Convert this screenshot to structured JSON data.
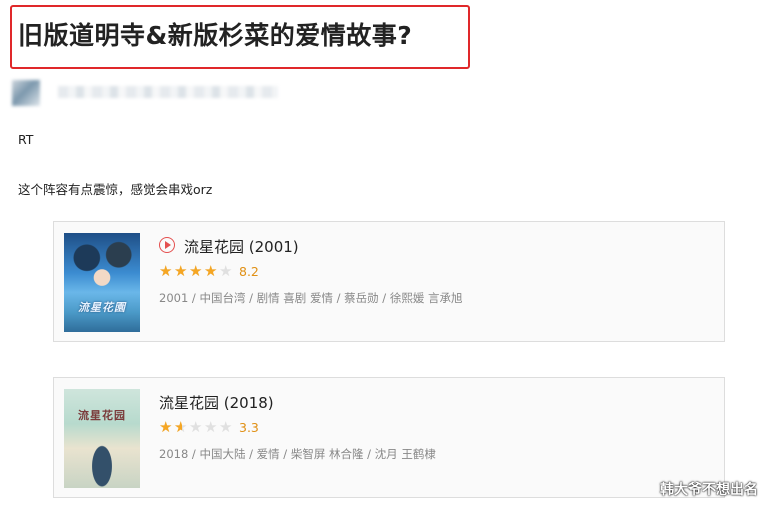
{
  "post": {
    "title": "旧版道明寺&新版杉菜的爱情故事?",
    "paragraph1": "RT",
    "paragraph2": "这个阵容有点震惊，感觉会串戏orz"
  },
  "cards": [
    {
      "title": "流星花园 (2001)",
      "rating": "8.2",
      "stars": 4,
      "meta": "2001 / 中国台湾 / 剧情 喜剧 爱情 / 蔡岳勋 / 徐熙媛 言承旭",
      "poster_text": "流星花園",
      "has_play_icon": true
    },
    {
      "title": "流星花园 (2018)",
      "rating": "3.3",
      "stars": 1.5,
      "meta": "2018 / 中国大陆 / 爱情 / 柴智屏 林合隆 / 沈月 王鹤棣",
      "poster_text": "流星花园",
      "has_play_icon": false
    }
  ],
  "watermark": "韩大爷不想出名"
}
